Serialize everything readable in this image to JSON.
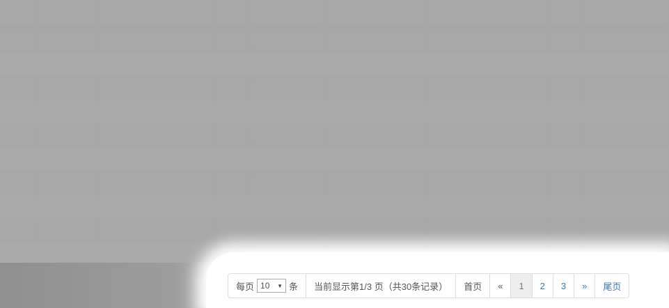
{
  "table": {
    "columns": [
      "",
      "",
      "",
      "",
      "",
      "",
      "",
      "",
      ""
    ],
    "rows": [
      [
        "",
        "",
        "",
        "",
        "",
        "",
        "",
        "",
        ""
      ],
      [
        "",
        "",
        "",
        "",
        "",
        "",
        "",
        "",
        ""
      ],
      [
        "",
        "",
        "",
        "",
        "",
        "",
        "",
        "",
        ""
      ],
      [
        "",
        "",
        "",
        "",
        "",
        "",
        "",
        "",
        ""
      ],
      [
        "",
        "",
        "",
        "",
        "",
        "",
        "",
        "",
        ""
      ],
      [
        "",
        "",
        "",
        "",
        "",
        "",
        "",
        "",
        ""
      ],
      [
        "",
        "",
        "",
        "",
        "",
        "",
        "",
        "",
        ""
      ],
      [
        "",
        "",
        "",
        "",
        "",
        "",
        "",
        "",
        ""
      ],
      [
        "",
        "",
        "",
        "",
        "",
        "",
        "",
        "",
        ""
      ],
      [
        "",
        "",
        "",
        "",
        "",
        "",
        "",
        "",
        ""
      ]
    ]
  },
  "pagination": {
    "per_page_label": "每页",
    "page_size": "10",
    "items_unit": "条",
    "status_text": "当前显示第1/3 页（共30条记录）",
    "first_label": "首页",
    "prev_label": "«",
    "pages": [
      "1",
      "2",
      "3"
    ],
    "next_label": "»",
    "last_label": "尾页"
  }
}
